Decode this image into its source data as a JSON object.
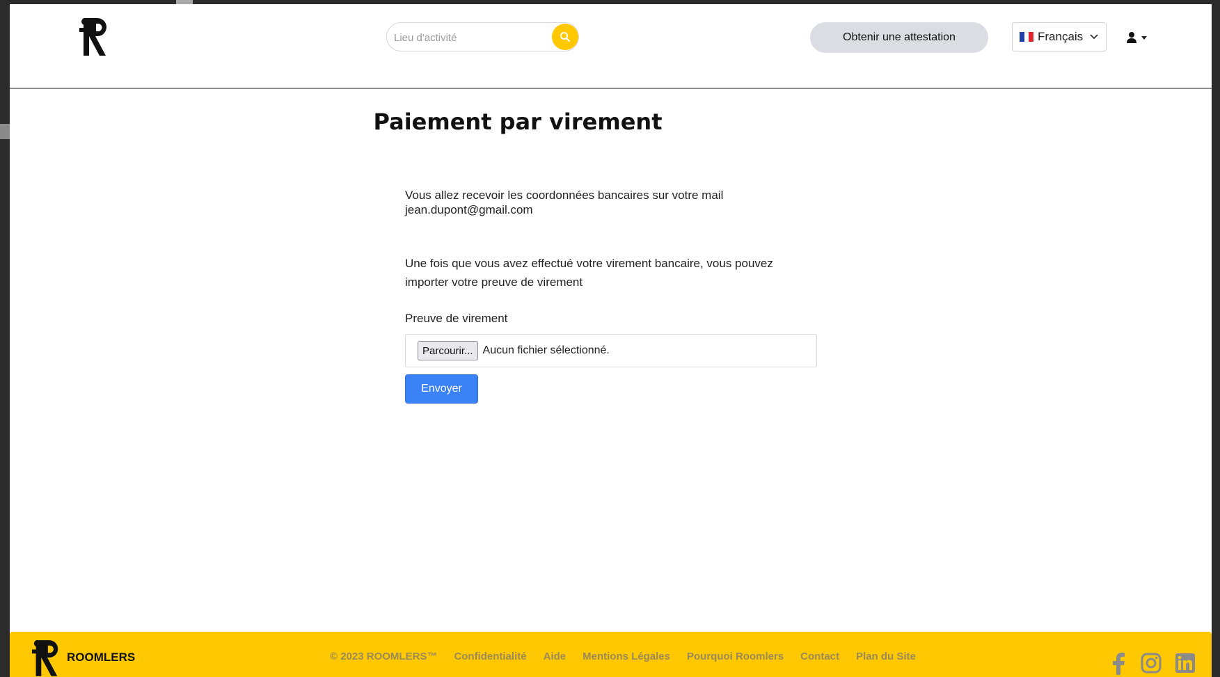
{
  "header": {
    "search": {
      "placeholder": "Lieu d'activité"
    },
    "attestation_button": "Obtenir une attestation",
    "language": {
      "selected": "Français"
    }
  },
  "main": {
    "title": "Paiement par virement",
    "info_line1": "Vous allez recevoir les coordonnées bancaires sur votre mail",
    "email": "jean.dupont@gmail.com",
    "instructions": "Une fois que vous avez effectué votre virement bancaire, vous pouvez importer votre preuve de virement",
    "file_label": "Preuve de virement",
    "browse_button": "Parcourir...",
    "file_status": "Aucun fichier sélectionné.",
    "submit_button": "Envoyer"
  },
  "footer": {
    "brand": "ROOMLERS",
    "copyright": "© 2023 ROOMLERS™",
    "links": [
      "Confidentialité",
      "Aide",
      "Mentions Légales",
      "Pourquoi Roomlers",
      "Contact",
      "Plan du Site"
    ]
  },
  "colors": {
    "accent_yellow": "#ffc800",
    "primary_blue": "#3b82f6",
    "pill_grey": "#dcdde2"
  },
  "icons": {
    "search": "search-icon",
    "flag": "france-flag-icon",
    "chevron": "chevron-down-icon",
    "user": "user-icon",
    "facebook": "facebook-icon",
    "instagram": "instagram-icon",
    "linkedin": "linkedin-icon"
  }
}
